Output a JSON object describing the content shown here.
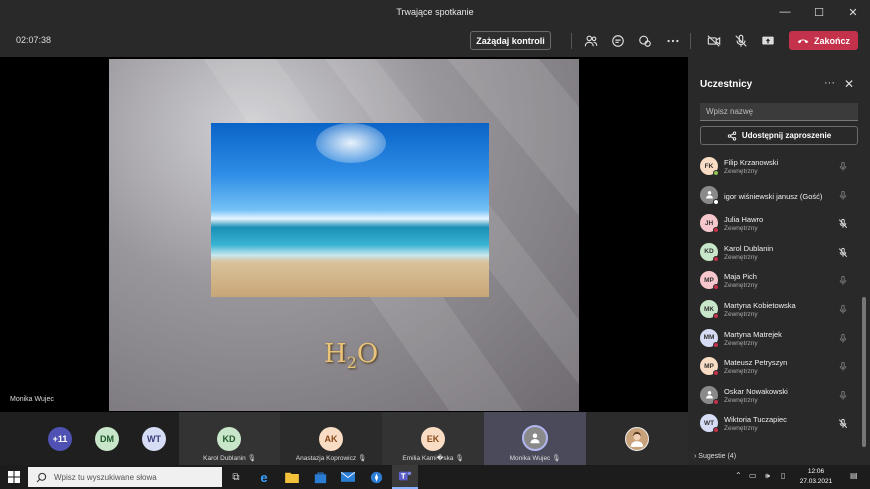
{
  "window": {
    "title": "Trwające spotkanie",
    "controls": [
      "—",
      "☐",
      "✕"
    ]
  },
  "toolbar": {
    "timer": "02:07:38",
    "request_control": "Zażądaj kontroli",
    "end_call": "Zakończ"
  },
  "stage": {
    "slide_text_main": "H",
    "slide_text_sub": "2",
    "slide_text_tail": "O",
    "presenter": "Monika Wujec"
  },
  "gallery": {
    "overflow": "+11",
    "small": [
      {
        "initials": "DM",
        "color": "#c8e6c9"
      },
      {
        "initials": "WT",
        "color": "#d7dcf5"
      }
    ],
    "tiles": [
      {
        "initials": "KD",
        "name": "Karol Dublanin",
        "color": "#c8e6c9"
      },
      {
        "initials": "AK",
        "name": "Anastazja Koprowicz",
        "color": "#f9dcc4"
      },
      {
        "initials": "EK",
        "name": "Emilia Kami�ska",
        "color": "#f9dcc4"
      },
      {
        "initials": "",
        "name": "Monika Wujec",
        "color": "#8a8a8a"
      },
      {
        "initials": "",
        "name": "",
        "color": "#c8a27a"
      }
    ]
  },
  "panel": {
    "title": "Uczestnicy",
    "search_placeholder": "Wpisz nazwę",
    "invite": "Udostępnij zaproszenie",
    "participants": [
      {
        "initials": "FK",
        "name": "Filip Krzanowski",
        "sub": "Zewnętrzny",
        "color": "#f9dcc4",
        "status": "#92c353",
        "muted": false
      },
      {
        "initials": "",
        "name": "igor wiśniewski janusz (Gość)",
        "sub": "",
        "color": "#8a8a8a",
        "status": "#ffffff",
        "muted": false
      },
      {
        "initials": "JH",
        "name": "Julia Hawro",
        "sub": "Zewnętrzny",
        "color": "#f6c7cc",
        "status": "#c4314b",
        "muted": true
      },
      {
        "initials": "KD",
        "name": "Karol Dublanin",
        "sub": "Zewnętrzny",
        "color": "#c8e6c9",
        "status": "#c4314b",
        "muted": true
      },
      {
        "initials": "MP",
        "name": "Maja Pich",
        "sub": "Zewnętrzny",
        "color": "#f6c7cc",
        "status": "#c4314b",
        "muted": false
      },
      {
        "initials": "MK",
        "name": "Martyna Kobietowska",
        "sub": "Zewnętrzny",
        "color": "#c8e6c9",
        "status": "#c4314b",
        "muted": false
      },
      {
        "initials": "MM",
        "name": "Martyna Matrejek",
        "sub": "Zewnętrzny",
        "color": "#d7dcf5",
        "status": "#c4314b",
        "muted": false
      },
      {
        "initials": "MP",
        "name": "Mateusz Petryszyn",
        "sub": "Zewnętrzny",
        "color": "#f9dcc4",
        "status": "#c4314b",
        "muted": false
      },
      {
        "initials": "",
        "name": "Oskar Nowakowski",
        "sub": "Zewnętrzny",
        "color": "#8a8a8a",
        "status": "#c4314b",
        "muted": false
      },
      {
        "initials": "WT",
        "name": "Wiktoria Tuczapiec",
        "sub": "Zewnętrzny",
        "color": "#d7dcf5",
        "status": "#c4314b",
        "muted": true
      }
    ],
    "suggestions": "Sugestie (4)"
  },
  "taskbar": {
    "search_placeholder": "Wpisz tu wyszukiwane słowa",
    "time": "12:06",
    "date": "27.03.2021"
  }
}
